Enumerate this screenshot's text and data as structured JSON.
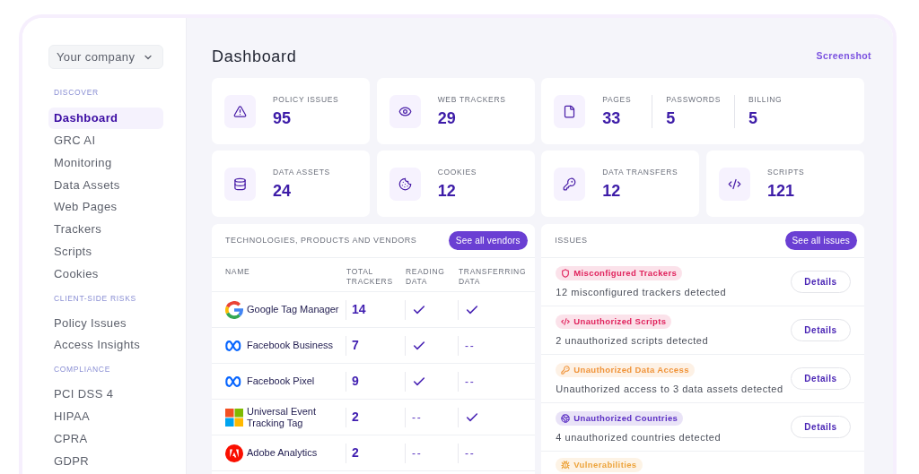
{
  "sidebar": {
    "company_selector": "Your company",
    "sections": [
      {
        "heading": "DISCOVER",
        "items": [
          {
            "label": "Dashboard",
            "selected": true
          },
          {
            "label": "GRC AI",
            "selected": false
          },
          {
            "label": "Monitoring",
            "selected": false
          },
          {
            "label": "Data Assets",
            "selected": false
          },
          {
            "label": "Web Pages",
            "selected": false
          },
          {
            "label": "Trackers",
            "selected": false
          },
          {
            "label": "Scripts",
            "selected": false
          },
          {
            "label": "Cookies",
            "selected": false
          }
        ]
      },
      {
        "heading": "CLIENT-SIDE RISKS",
        "items": [
          {
            "label": "Policy Issues",
            "selected": false
          },
          {
            "label": "Access Insights",
            "selected": false
          }
        ]
      },
      {
        "heading": "COMPLIANCE",
        "items": [
          {
            "label": "PCI DSS 4",
            "selected": false
          },
          {
            "label": "HIPAA",
            "selected": false
          },
          {
            "label": "CPRA",
            "selected": false
          },
          {
            "label": "GDPR",
            "selected": false
          }
        ]
      }
    ]
  },
  "header": {
    "title": "Dashboard",
    "link": "Screenshot"
  },
  "stat_cards": [
    {
      "metrics": [
        {
          "label": "POLICY ISSUES",
          "value": "95"
        }
      ]
    },
    {
      "metrics": [
        {
          "label": "WEB TRACKERS",
          "value": "29"
        }
      ]
    },
    {
      "metrics": [
        {
          "label": "PAGES",
          "value": "33"
        },
        {
          "label": "PASSWORDS",
          "value": "5"
        },
        {
          "label": "BILLING",
          "value": "5"
        }
      ]
    },
    {
      "metrics": [
        {
          "label": "DATA ASSETS",
          "value": "24"
        }
      ]
    },
    {
      "metrics": [
        {
          "label": "COOKIES",
          "value": "12"
        }
      ]
    },
    {
      "metrics": [
        {
          "label": "DATA TRANSFERS",
          "value": "12"
        }
      ]
    },
    {
      "metrics": [
        {
          "label": "SCRIPTS",
          "value": "121"
        }
      ]
    }
  ],
  "vendors_table": {
    "title": "TECHNOLOGIES, PRODUCTS AND VENDORS",
    "button": "See all vendors",
    "columns": [
      "NAME",
      "TOTAL TRACKERS",
      "READING DATA",
      "TRANSFERRING DATA"
    ],
    "rows": [
      {
        "name": "Google Tag Manager",
        "total_trackers": "14",
        "reading_data": {
          "checked": true
        },
        "transferring_data": {
          "checked": true
        }
      },
      {
        "name": "Facebook Business",
        "total_trackers": "7",
        "reading_data": {
          "checked": true
        },
        "transferring_data": {
          "checked": false,
          "text": "--"
        }
      },
      {
        "name": "Facebook Pixel",
        "total_trackers": "9",
        "reading_data": {
          "checked": true
        },
        "transferring_data": {
          "checked": false,
          "text": "--"
        }
      },
      {
        "name": "Universal Event Tracking Tag",
        "total_trackers": "2",
        "reading_data": {
          "checked": false,
          "text": "--"
        },
        "transferring_data": {
          "checked": true
        }
      },
      {
        "name": "Adobe Analytics",
        "total_trackers": "2",
        "reading_data": {
          "checked": false,
          "text": "--"
        },
        "transferring_data": {
          "checked": false,
          "text": "--"
        }
      }
    ]
  },
  "issues_panel": {
    "title": "ISSUES",
    "button": "See all issues",
    "items": [
      {
        "badge": "Misconfigured Trackers",
        "color": "#e0245e",
        "description": "12 misconfigured trackers detected",
        "action": "Details"
      },
      {
        "badge": "Unauthorized Scripts",
        "color": "#e0245e",
        "description": "2 unauthorized scripts detected",
        "action": "Details"
      },
      {
        "badge": "Unauthorized Data Access",
        "color": "#f0943a",
        "description": "Unauthorized access to 3 data assets detected",
        "action": "Details"
      },
      {
        "badge": "Unauthorized Countries",
        "color": "#5b2fc4",
        "description": "4 unauthorized countries detected",
        "action": "Details"
      },
      {
        "badge": "Vulnerabilities",
        "color": "#eda43c"
      }
    ]
  }
}
